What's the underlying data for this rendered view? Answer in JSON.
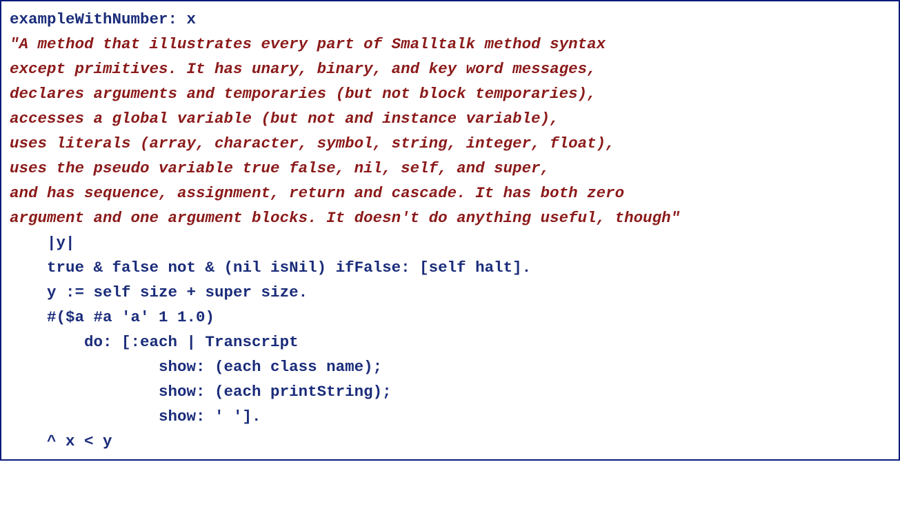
{
  "colors": {
    "border": "#0c1b7a",
    "selector": "#1a2c7a",
    "comment": "#8b1a1a",
    "code": "#1a2c7a"
  },
  "source": {
    "selector": "exampleWithNumber: x",
    "comment_lines": [
      "\"A method that illustrates every part of Smalltalk method syntax",
      "except primitives. It has unary, binary, and key word messages,",
      "declares arguments and temporaries (but not block temporaries),",
      "accesses a global variable (but not and instance variable),",
      "uses literals (array, character, symbol, string, integer, float),",
      "uses the pseudo variable true false, nil, self, and super,",
      "and has sequence, assignment, return and cascade. It has both zero",
      "argument and one argument blocks. It doesn't do anything useful, though\""
    ],
    "body_lines": [
      "    |y|",
      "    true & false not & (nil isNil) ifFalse: [self halt].",
      "    y := self size + super size.",
      "    #($a #a 'a' 1 1.0)",
      "        do: [:each | Transcript",
      "                show: (each class name);",
      "                show: (each printString);",
      "                show: ' '].",
      "    ^ x < y"
    ]
  }
}
